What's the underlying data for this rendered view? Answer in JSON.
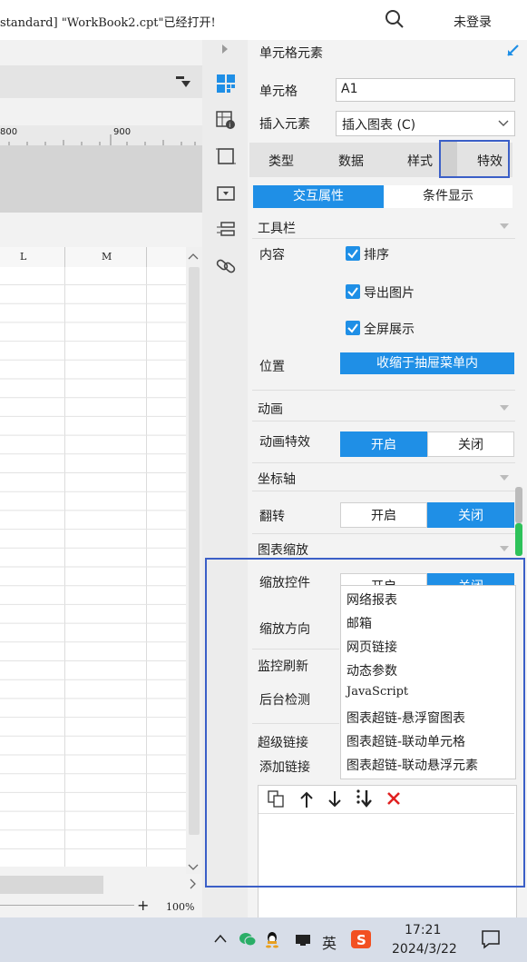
{
  "titlebar": {
    "title": "standard] \"WorkBook2.cpt\"已经打开!",
    "login": "未登录"
  },
  "spreadsheet": {
    "ruler_marks": [
      "800",
      "900"
    ],
    "columns": [
      "L",
      "M"
    ],
    "zoom": "100%",
    "zoom_plus": "+"
  },
  "panel": {
    "header": "单元格元素",
    "cell_label": "单元格",
    "cell_value": "A1",
    "insert_label": "插入元素",
    "insert_value": "插入图表 (C)",
    "tabs": [
      "类型",
      "数据",
      "样式",
      "特效"
    ],
    "subtabs": {
      "interaction": "交互属性",
      "condition": "条件显示"
    },
    "toolbar_section": "工具栏",
    "content_label": "内容",
    "checkboxes": [
      "排序",
      "导出图片",
      "全屏展示"
    ],
    "position_label": "位置",
    "position_value": "收缩于抽屉菜单内",
    "animation_section": "动画",
    "animation_effect_label": "动画特效",
    "axis_section": "坐标轴",
    "flip_label": "翻转",
    "zoom_section": "图表缩放",
    "zoom_control_label": "缩放控件",
    "zoom_dir_label": "缩放方向",
    "monitor_section": "监控刷新",
    "backend_label": "后台检测",
    "hyperlink_section": "超级链接",
    "add_link_label": "添加链接",
    "on": "开启",
    "off": "关闭"
  },
  "dropdown": {
    "items": [
      "网络报表",
      "邮箱",
      "网页链接",
      "动态参数",
      "JavaScript",
      "图表超链-悬浮窗图表",
      "图表超链-联动单元格",
      "图表超链-联动悬浮元素"
    ]
  },
  "taskbar": {
    "ime": "英",
    "time": "17:21",
    "date": "2024/3/22"
  },
  "colors": {
    "accent": "#1f8fe6",
    "highlight": "#3b5fc7",
    "close": "#e02020"
  }
}
